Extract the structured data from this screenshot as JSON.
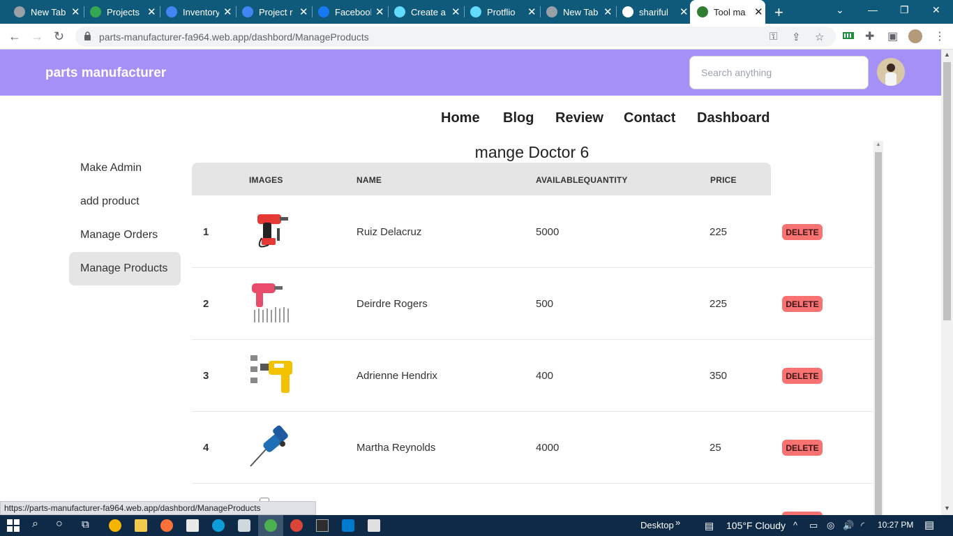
{
  "browser": {
    "tabs": [
      {
        "title": "New Tab",
        "icon": "chrome-icon",
        "color": "#9aa0a6"
      },
      {
        "title": "Projects",
        "icon": "google-drive-icon",
        "color": "#34a853"
      },
      {
        "title": "Inventory",
        "icon": "google-docs-icon",
        "color": "#4285f4"
      },
      {
        "title": "Project r",
        "icon": "google-docs-icon",
        "color": "#4285f4"
      },
      {
        "title": "Facebook",
        "icon": "facebook-icon",
        "color": "#1877f2"
      },
      {
        "title": "Create a",
        "icon": "react-icon",
        "color": "#61dafb"
      },
      {
        "title": "Protflio",
        "icon": "react-icon",
        "color": "#61dafb"
      },
      {
        "title": "New Tab",
        "icon": "chrome-icon",
        "color": "#9aa0a6"
      },
      {
        "title": "shariful",
        "icon": "github-icon",
        "color": "#ffffff"
      },
      {
        "title": "Tool ma",
        "icon": "tool-icon",
        "color": "#2e7d32"
      }
    ],
    "url": "parts-manufacturer-fa964.web.app/dashbord/ManageProducts",
    "status_url": "https://parts-manufacturer-fa964.web.app/dashbord/ManageProducts"
  },
  "app": {
    "brand": "parts manufacturer",
    "search_placeholder": "Search anything",
    "header_color": "#a490f7",
    "nav": [
      "Home",
      "Blog",
      "Review",
      "Contact",
      "Dashboard"
    ],
    "sidebar": [
      {
        "label": "Make Admin",
        "active": false
      },
      {
        "label": "add product",
        "active": false
      },
      {
        "label": "Manage Orders",
        "active": false
      },
      {
        "label": "Manage Products",
        "active": true
      }
    ],
    "page_title": "mange Doctor 6",
    "table": {
      "headers": [
        "IMAGES",
        "NAME",
        "AVAILABLEQUANTITY",
        "PRICE"
      ],
      "delete_label": "DELETE",
      "rows": [
        {
          "num": "1",
          "name": "Ruiz Delacruz",
          "quantity": "5000",
          "price": "225",
          "image": "drill-icon"
        },
        {
          "num": "2",
          "name": "Deirdre Rogers",
          "quantity": "500",
          "price": "225",
          "image": "drill-set-icon"
        },
        {
          "num": "3",
          "name": "Adrienne Hendrix",
          "quantity": "400",
          "price": "350",
          "image": "heat-gun-icon"
        },
        {
          "num": "4",
          "name": "Martha Reynolds",
          "quantity": "4000",
          "price": "25",
          "image": "rotary-hammer-icon"
        }
      ]
    }
  },
  "taskbar": {
    "desktop_label": "Desktop",
    "weather": "105°F  Cloudy",
    "time": "10:27 PM"
  }
}
